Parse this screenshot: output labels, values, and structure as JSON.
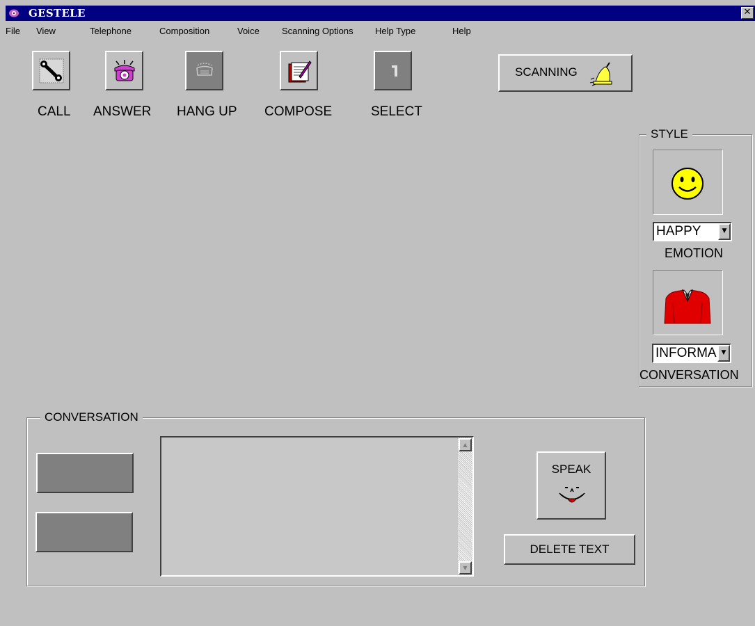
{
  "window": {
    "title": "GESTELE",
    "close_glyph": "✕"
  },
  "menu": [
    "File",
    "View",
    "Telephone",
    "Composition",
    "Voice",
    "Scanning Options",
    "Help Type",
    "Help"
  ],
  "toolbar": {
    "call": "CALL",
    "answer": "ANSWER",
    "hang_up": "HANG UP",
    "compose": "COMPOSE",
    "select": "SELECT",
    "scanning": "SCANNING"
  },
  "style_panel": {
    "caption": "STYLE",
    "emotion_value": "HAPPY",
    "emotion_label": "EMOTION",
    "conversation_value": "INFORMA",
    "conversation_label": "CONVERSATION"
  },
  "conversation": {
    "caption": "CONVERSATION",
    "text": "",
    "speak": "SPEAK",
    "delete": "DELETE TEXT"
  },
  "colors": {
    "face": "#c0c0c0",
    "titlebar": "#000080",
    "smiley": "#ffff00",
    "shirt": "#e00000",
    "phone": "#d040d0"
  },
  "icons": [
    "phone-handset-icon",
    "pink-telephone-icon",
    "hang-up-icon",
    "compose-icon",
    "select-icon",
    "bell-icon",
    "smiley-icon",
    "shirt-icon",
    "speaking-face-icon"
  ]
}
